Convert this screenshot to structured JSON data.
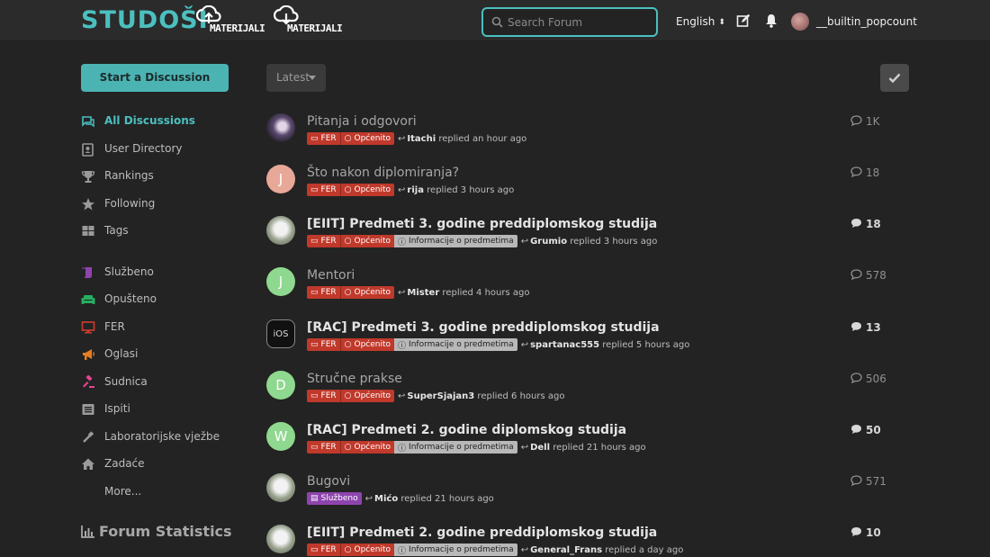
{
  "header": {
    "logo": "STUDOŠI",
    "materijali_1": "MATERIJALI",
    "materijali_2": "MATERIJALI",
    "search_placeholder": "Search Forum",
    "language": "English",
    "username": "__builtin_popcount",
    "colors": {
      "accent": "#4cbfbf",
      "header_bg": "#2b2b2b"
    }
  },
  "sidebar": {
    "start_label": "Start a Discussion",
    "items": [
      {
        "label": "All Discussions",
        "icon": "comments-icon",
        "color": "#4cbfbf"
      },
      {
        "label": "User Directory",
        "icon": "address-card-icon",
        "color": "#9a9a9a"
      },
      {
        "label": "Rankings",
        "icon": "trophy-icon",
        "color": "#9a9a9a"
      },
      {
        "label": "Following",
        "icon": "star-icon",
        "color": "#9a9a9a"
      },
      {
        "label": "Tags",
        "icon": "grid-icon",
        "color": "#9a9a9a"
      },
      {
        "label": "Službeno",
        "icon": "scroll-icon",
        "color": "#8e44ad"
      },
      {
        "label": "Opušteno",
        "icon": "couch-icon",
        "color": "#27ae60"
      },
      {
        "label": "FER",
        "icon": "desktop-icon",
        "color": "#c0392b"
      },
      {
        "label": "Oglasi",
        "icon": "megaphone-icon",
        "color": "#e67e22"
      },
      {
        "label": "Sudnica",
        "icon": "gavel-icon",
        "color": "#e84393"
      },
      {
        "label": "Ispiti",
        "icon": "list-icon",
        "color": "#9a9a9a"
      },
      {
        "label": "Laboratorijske vježbe",
        "icon": "eyedropper-icon",
        "color": "#9a9a9a"
      },
      {
        "label": "Zadaće",
        "icon": "home-icon",
        "color": "#9a9a9a"
      },
      {
        "label": "More...",
        "icon": "",
        "color": "#9a9a9a"
      }
    ],
    "stats_label": "Forum Statistics"
  },
  "toolbar": {
    "sort_label": "Latest"
  },
  "tags": {
    "fer": "FER",
    "opcenito": "Općenito",
    "info": "Informacije o predmetima",
    "sluzbeno": "Službeno"
  },
  "discussions": [
    {
      "title": "Pitanja i odgovori",
      "user": "Itachi",
      "time": "replied an hour ago",
      "count": "1K",
      "unread": false,
      "avatar": "image",
      "tags": [
        "fer",
        "opcenito"
      ]
    },
    {
      "title": "Što nakon diplomiranja?",
      "user": "rija",
      "time": "replied 3 hours ago",
      "count": "18",
      "unread": false,
      "avatar": "J",
      "avatar_color": "#e8a898",
      "tags": [
        "fer",
        "opcenito"
      ]
    },
    {
      "title": "[EIIT] Predmeti 3. godine preddiplomskog studija",
      "user": "Grumio",
      "time": "replied 3 hours ago",
      "count": "18",
      "unread": true,
      "avatar": "image",
      "tags": [
        "fer",
        "opcenito",
        "info"
      ]
    },
    {
      "title": "Mentori",
      "user": "Mister",
      "time": "replied 4 hours ago",
      "count": "578",
      "unread": false,
      "avatar": "J",
      "avatar_color": "#8fd88f",
      "tags": [
        "fer",
        "opcenito"
      ]
    },
    {
      "title": "[RAC] Predmeti 3. godine preddiplomskog studija",
      "user": "spartanac555",
      "time": "replied 5 hours ago",
      "count": "13",
      "unread": true,
      "avatar": "iOS",
      "tags": [
        "fer",
        "opcenito",
        "info"
      ]
    },
    {
      "title": "Stručne prakse",
      "user": "SuperSjajan3",
      "time": "replied 6 hours ago",
      "count": "506",
      "unread": false,
      "avatar": "D",
      "avatar_color": "#8fd88f",
      "tags": [
        "fer",
        "opcenito"
      ]
    },
    {
      "title": "[RAC] Predmeti 2. godine diplomskog studija",
      "user": "Dell",
      "time": "replied 21 hours ago",
      "count": "50",
      "unread": true,
      "avatar": "W",
      "avatar_color": "#8fd88f",
      "tags": [
        "fer",
        "opcenito",
        "info"
      ]
    },
    {
      "title": "Bugovi",
      "user": "Mićo",
      "time": "replied 21 hours ago",
      "count": "571",
      "unread": false,
      "avatar": "image",
      "tags": [
        "sluzbeno"
      ]
    },
    {
      "title": "[EIIT] Predmeti 2. godine preddiplomskog studija",
      "user": "General_Frans",
      "time": "replied a day ago",
      "count": "10",
      "unread": true,
      "avatar": "image",
      "tags": [
        "fer",
        "opcenito",
        "info"
      ]
    }
  ]
}
